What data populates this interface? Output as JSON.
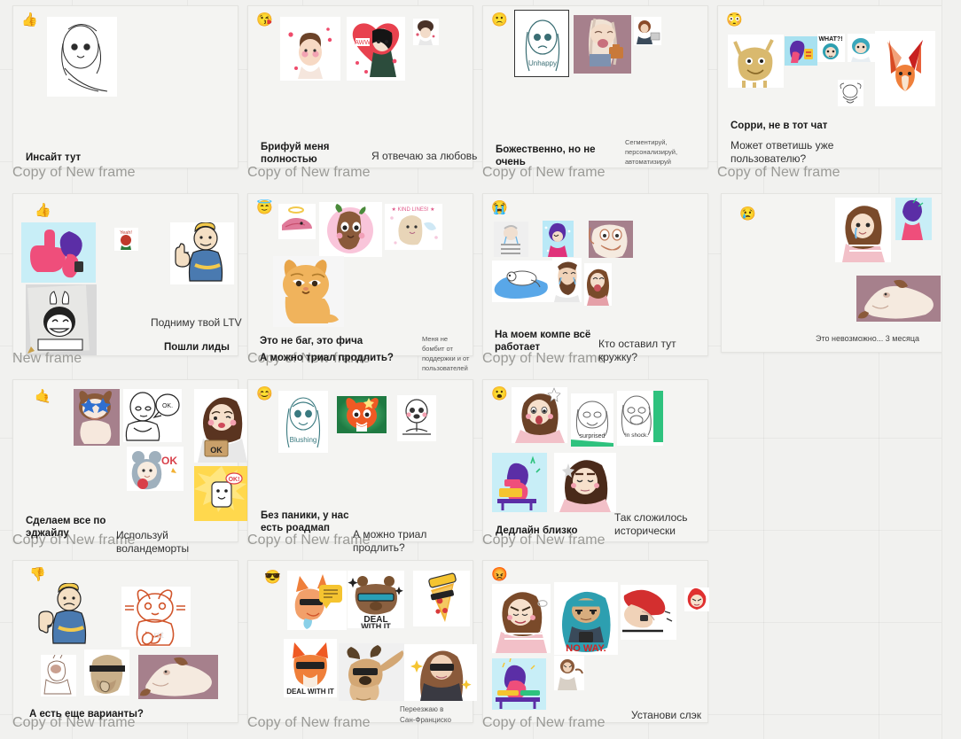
{
  "board": {
    "background_color": "#f1f1ef",
    "frame_background": "#f4f4f2",
    "frame_label_color": "#9a9a96"
  },
  "frames": [
    {
      "id": "frame-1",
      "label": "Copy of New frame",
      "emoji": "👍",
      "emoji_name": "thumbs-up-emoji",
      "captions": [
        {
          "text": "Инсайт тут",
          "style": "bold"
        }
      ],
      "stickers": [
        {
          "name": "sticker-sketch-girl-portrait",
          "colors": [
            "#ffffff",
            "#2b2b2b"
          ]
        }
      ]
    },
    {
      "id": "frame-2",
      "label": "Copy of New frame",
      "emoji": "😘",
      "emoji_name": "kissing-heart-emoji",
      "captions": [
        {
          "text": "Брифуй меня полностью",
          "style": "bold"
        },
        {
          "text": "Я отвечаю за любовь",
          "style": "reg"
        }
      ],
      "stickers": [
        {
          "name": "sticker-blushing-girl-hearts",
          "colors": [
            "#ffffff",
            "#f08ca0"
          ]
        },
        {
          "name": "sticker-aww-heart-girl",
          "colors": [
            "#ffffff",
            "#e8414e"
          ]
        },
        {
          "name": "sticker-curly-hair-hearts",
          "colors": [
            "#ffffff",
            "#4a3228"
          ]
        },
        {
          "name": "sticker-small-heart-doodle",
          "colors": [
            "#d6d6d6",
            "#c8344a"
          ]
        },
        {
          "name": "sticker-purple-hair-kiss",
          "colors": [
            "#8e8fa8",
            "#6d4ea6"
          ]
        }
      ]
    },
    {
      "id": "frame-3",
      "label": "Copy of New frame",
      "emoji": "🙁",
      "emoji_name": "slightly-frowning-emoji",
      "captions": [
        {
          "text": "Божественно, но не очень",
          "style": "bold"
        },
        {
          "text": "Сегментируй, персонализируй, автоматизируй",
          "style": "tiny"
        }
      ],
      "stickers": [
        {
          "name": "sticker-unhappy-sketch-girl",
          "colors": [
            "#ffffff",
            "#3a6e74"
          ]
        },
        {
          "name": "sticker-tired-woman-bag",
          "colors": [
            "#a6808c",
            "#e8c9a0"
          ]
        },
        {
          "name": "sticker-person-laptop",
          "colors": [
            "#ffffff",
            "#8a4b2a"
          ]
        }
      ]
    },
    {
      "id": "frame-4",
      "label": "Copy of New frame",
      "emoji": "😳",
      "emoji_name": "flushed-face-emoji",
      "captions": [
        {
          "text": "Сорри, не в тот чат",
          "style": "bold"
        },
        {
          "text": "Может ответишь уже пользователю?",
          "style": "reg"
        }
      ],
      "stickers": [
        {
          "name": "sticker-yellow-monster",
          "colors": [
            "#ffffff",
            "#d6b877"
          ]
        },
        {
          "name": "sticker-pink-character-blue-bg",
          "colors": [
            "#a8e1f0",
            "#d23b8c"
          ]
        },
        {
          "name": "sticker-what-blue-hair-girl",
          "colors": [
            "#ffffff",
            "#2d9fb0"
          ]
        },
        {
          "name": "sticker-blue-hair-shock",
          "colors": [
            "#ffffff",
            "#3aa7bb"
          ]
        },
        {
          "name": "sticker-sketch-doodle-small",
          "colors": [
            "#ffffff",
            "#444444"
          ]
        },
        {
          "name": "sticker-origami-fox",
          "colors": [
            "#ffffff",
            "#ef5a24"
          ]
        }
      ]
    },
    {
      "id": "frame-5",
      "label": "New frame",
      "emoji": "👍",
      "emoji_name": "thumbs-up-emoji",
      "captions": [
        {
          "text": "Подниму твой LTV",
          "style": "reg"
        },
        {
          "text": "Пошли лиды",
          "style": "bold"
        }
      ],
      "stickers": [
        {
          "name": "sticker-pink-thumbsup-character",
          "colors": [
            "#c8eef7",
            "#ef4e7b"
          ]
        },
        {
          "name": "sticker-tiny-red-doodle",
          "colors": [
            "#ffffff",
            "#c0392b"
          ]
        },
        {
          "name": "sticker-vault-boy-thumbs-up",
          "colors": [
            "#ffffff",
            "#3f6fa8"
          ]
        },
        {
          "name": "sticker-bunny-paper-sketch",
          "colors": [
            "#d9d9d9",
            "#222222"
          ]
        }
      ]
    },
    {
      "id": "frame-6",
      "label": "Copy of New frame",
      "emoji": "😇",
      "emoji_name": "angel-emoji",
      "captions": [
        {
          "text": "Это не баг, это фича",
          "style": "bold"
        },
        {
          "text": "А можно триал продлить?",
          "style": "bold"
        },
        {
          "text": "Меня не бомбит от поддержки и от пользователей",
          "style": "tiny"
        }
      ],
      "stickers": [
        {
          "name": "sticker-angel-halo-pink",
          "colors": [
            "#ffffff",
            "#e07a9a"
          ]
        },
        {
          "name": "sticker-baby-groot",
          "colors": [
            "#ffffff",
            "#8a5a3a"
          ]
        },
        {
          "name": "sticker-kind-angel-girl",
          "colors": [
            "#ffffff",
            "#e4c9d8"
          ]
        },
        {
          "name": "sticker-sad-orange-cat",
          "colors": [
            "#f6f6f6",
            "#e8a54a"
          ]
        }
      ]
    },
    {
      "id": "frame-7",
      "label": "Copy of New frame",
      "emoji": "😭",
      "emoji_name": "loudly-crying-emoji",
      "captions": [
        {
          "text": "На моем компе всё работает",
          "style": "bold"
        },
        {
          "text": "Кто оставил тут кружку?",
          "style": "reg"
        }
      ],
      "stickers": [
        {
          "name": "sticker-crying-striped-person",
          "colors": [
            "#efefef",
            "#888888"
          ]
        },
        {
          "name": "sticker-crying-purple-hair",
          "colors": [
            "#b9e9f7",
            "#5b2ea6"
          ]
        },
        {
          "name": "sticker-crying-dog",
          "colors": [
            "#a6808c",
            "#f2e4d8"
          ]
        },
        {
          "name": "sticker-puddle-tears",
          "colors": [
            "#ffffff",
            "#4d9fe0"
          ]
        },
        {
          "name": "sticker-crying-bearded-man",
          "colors": [
            "#ffffff",
            "#6b4228"
          ]
        },
        {
          "name": "sticker-crying-woman",
          "colors": [
            "#ffffff",
            "#7a4a2a"
          ]
        }
      ]
    },
    {
      "id": "frame-8",
      "label": "",
      "emoji": "😢",
      "emoji_name": "crying-face-emoji",
      "captions": [
        {
          "text": "Это невозможно... 3 месяца",
          "style": "small"
        }
      ],
      "stickers": [
        {
          "name": "sticker-crying-girl-tear",
          "colors": [
            "#ffffff",
            "#7a4a2a"
          ]
        },
        {
          "name": "sticker-melting-purple-character",
          "colors": [
            "#c8eef7",
            "#5b2ea6"
          ]
        },
        {
          "name": "sticker-lying-dog-sad",
          "colors": [
            "#a6808c",
            "#f3e6de"
          ]
        }
      ]
    },
    {
      "id": "frame-9",
      "label": "Copy of New frame",
      "emoji": "🤙",
      "emoji_name": "call-me-hand-emoji",
      "captions": [
        {
          "text": "Сделаем все по эджайлу",
          "style": "bold"
        },
        {
          "text": "Используй воландеморты",
          "style": "reg"
        }
      ],
      "stickers": [
        {
          "name": "sticker-star-eyes-cat",
          "colors": [
            "#a6808c",
            "#efd9d0"
          ]
        },
        {
          "name": "sticker-saitama-ok",
          "colors": [
            "#ffffff",
            "#222222"
          ]
        },
        {
          "name": "sticker-girl-ok-sign",
          "colors": [
            "#ffffff",
            "#7a4a2a"
          ]
        },
        {
          "name": "sticker-mouse-hood-ok",
          "colors": [
            "#ffffff",
            "#e8a0b0"
          ]
        },
        {
          "name": "sticker-marshmallow-ok",
          "colors": [
            "#ffd84d",
            "#ffffff"
          ]
        }
      ]
    },
    {
      "id": "frame-10",
      "label": "Copy of New frame",
      "emoji": "😊",
      "emoji_name": "smiling-face-emoji",
      "captions": [
        {
          "text": "Без паники, у нас есть роадмап",
          "style": "bold"
        },
        {
          "text": "А можно триал продлить?",
          "style": "reg"
        }
      ],
      "stickers": [
        {
          "name": "sticker-blushing-sketch-girl",
          "colors": [
            "#ffffff",
            "#3a6e74"
          ]
        },
        {
          "name": "sticker-orange-cat-green-bg",
          "colors": [
            "#2e9e58",
            "#ef5a24"
          ]
        },
        {
          "name": "sticker-doodle-happy-person",
          "colors": [
            "#ffffff",
            "#333333"
          ]
        }
      ]
    },
    {
      "id": "frame-11",
      "label": "Copy of New frame",
      "emoji": "😮",
      "emoji_name": "open-mouth-emoji",
      "captions": [
        {
          "text": "Дедлайн близко",
          "style": "bold"
        },
        {
          "text": "Так сложилось исторически",
          "style": "reg"
        }
      ],
      "stickers": [
        {
          "name": "sticker-shocked-girl",
          "colors": [
            "#ffffff",
            "#7a4a2a"
          ]
        },
        {
          "name": "sticker-surprised-sketch",
          "colors": [
            "#ffffff",
            "#2ec27e"
          ]
        },
        {
          "name": "sticker-in-shock-sketch",
          "colors": [
            "#ffffff",
            "#2ec27e"
          ]
        },
        {
          "name": "sticker-purple-explosion-desk",
          "colors": [
            "#c8eef7",
            "#5b2ea6"
          ]
        },
        {
          "name": "sticker-annoyed-girl-glasses",
          "colors": [
            "#ffffff",
            "#4a2a1a"
          ]
        }
      ]
    },
    {
      "id": "frame-12",
      "label": "Copy of New frame",
      "emoji": "👎",
      "emoji_name": "thumbs-down-emoji",
      "captions": [
        {
          "text": "А есть еще варианты?",
          "style": "bold"
        }
      ],
      "stickers": [
        {
          "name": "sticker-vault-boy-thumbs-down",
          "colors": [
            "#f4f4f2",
            "#3f6fa8"
          ]
        },
        {
          "name": "sticker-orange-cat-outline-thumbs-down",
          "colors": [
            "#ffffff",
            "#d1552b"
          ]
        },
        {
          "name": "sticker-small-sketch-thumbs-down",
          "colors": [
            "#ffffff",
            "#8a4b2a"
          ]
        },
        {
          "name": "sticker-blindfold-thumbs-down",
          "colors": [
            "#ffffff",
            "#b59a72"
          ]
        },
        {
          "name": "sticker-lying-dog-thumbs-down",
          "colors": [
            "#a6808c",
            "#f3e6de"
          ]
        }
      ]
    },
    {
      "id": "frame-13",
      "label": "Copy of New frame",
      "emoji": "😎",
      "emoji_name": "sunglasses-emoji",
      "captions": [
        {
          "text": "Переезжаю в Сан-Франциско",
          "style": "tiny"
        }
      ],
      "stickers": [
        {
          "name": "sticker-cool-fox-message",
          "colors": [
            "#ffffff",
            "#ffc83d"
          ]
        },
        {
          "name": "sticker-deal-with-it-bear",
          "colors": [
            "#ffffff",
            "#7a5230"
          ]
        },
        {
          "name": "sticker-pizza-sunglasses",
          "colors": [
            "#ffffff",
            "#f2b134"
          ]
        },
        {
          "name": "sticker-fox-deal-with-it",
          "colors": [
            "#ffffff",
            "#ef5a24"
          ]
        },
        {
          "name": "sticker-dabbing-pug",
          "colors": [
            "#f0f0f0",
            "#d3a774"
          ]
        },
        {
          "name": "sticker-cool-girl-sunglasses",
          "colors": [
            "#ffffff",
            "#8a5a3a"
          ]
        }
      ]
    },
    {
      "id": "frame-14",
      "label": "Copy of New frame",
      "emoji": "😡",
      "emoji_name": "angry-face-emoji",
      "captions": [
        {
          "text": "Установи слэк",
          "style": "reg"
        }
      ],
      "stickers": [
        {
          "name": "sticker-angry-steam-girl",
          "colors": [
            "#ffffff",
            "#7a4a2a"
          ]
        },
        {
          "name": "sticker-no-way-blue-hair",
          "colors": [
            "#ffffff",
            "#2d9fb0"
          ]
        },
        {
          "name": "sticker-red-angry-hand",
          "colors": [
            "#ffffff",
            "#d32f2f"
          ]
        },
        {
          "name": "sticker-red-flame-face",
          "colors": [
            "#ffffff",
            "#e03030"
          ]
        },
        {
          "name": "sticker-purple-smash-desk",
          "colors": [
            "#c8eef7",
            "#5b2ea6"
          ]
        },
        {
          "name": "sticker-small-angry-figure",
          "colors": [
            "#ffffff",
            "#8a5a3a"
          ]
        }
      ]
    }
  ]
}
